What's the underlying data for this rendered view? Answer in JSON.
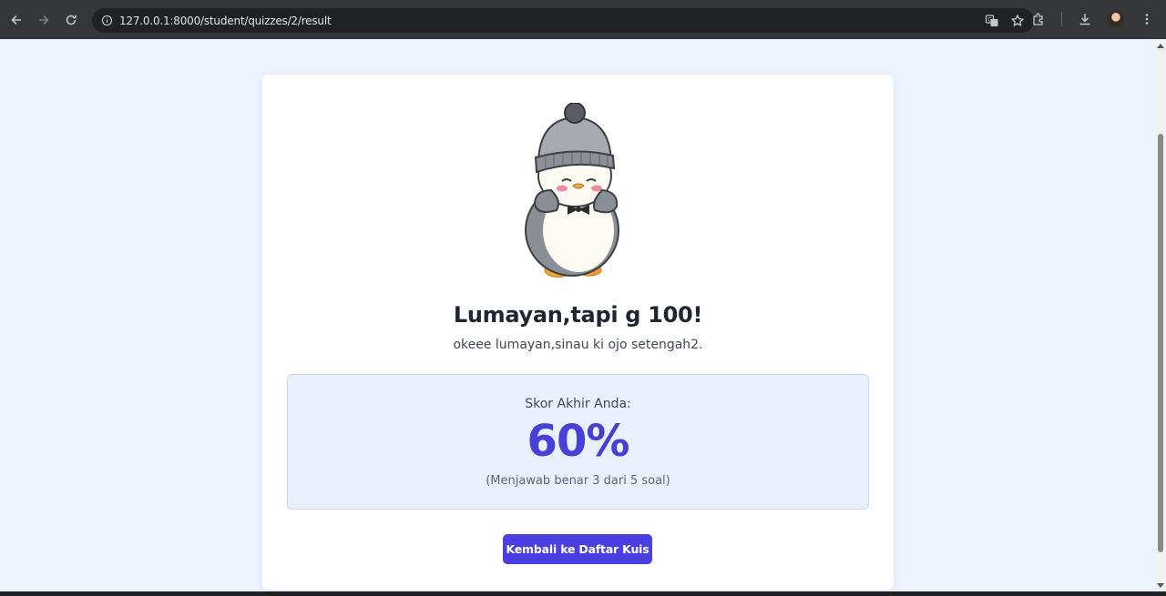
{
  "browser": {
    "url": "127.0.0.1:8000/student/quizzes/2/result"
  },
  "result": {
    "title": "Lumayan,tapi g 100!",
    "message": "okeee lumayan,sinau ki ojo setengah2."
  },
  "score": {
    "label": "Skor Akhir Anda:",
    "value": "60%",
    "detail": "(Menjawab benar 3 dari 5 soal)"
  },
  "actions": {
    "back_label": "Kembali ke Daftar Kuis"
  },
  "colors": {
    "accent": "#4a3fe0",
    "score_text": "#4540d6",
    "page_bg": "#eef4ff",
    "score_box_bg": "#eaf0fd"
  }
}
